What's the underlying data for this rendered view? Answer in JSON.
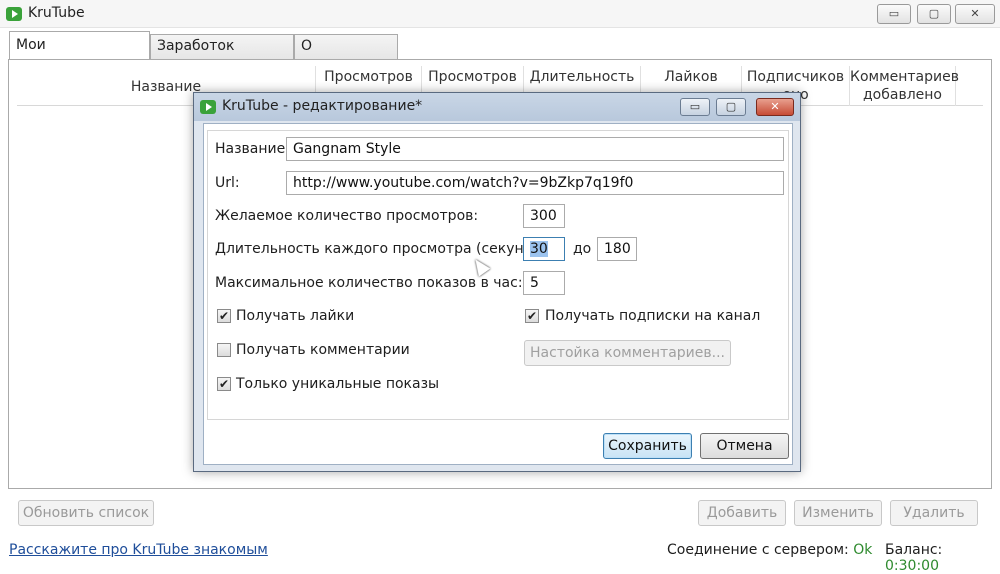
{
  "app": {
    "title": "KruTube",
    "window_buttons": {
      "minimize": "▭",
      "maximize": "▢",
      "close": "✕"
    }
  },
  "tabs": [
    {
      "label": "Мои видеоролики",
      "active": true
    },
    {
      "label": "Заработок времени",
      "active": false
    },
    {
      "label": "О программе",
      "active": false
    }
  ],
  "table": {
    "columns": [
      "Название",
      "Просмотров",
      "Просмотров",
      "Длительность",
      "Лайков",
      "Подписчиков\nено",
      "Комментариев\nдобавлено"
    ]
  },
  "bottom_buttons": {
    "refresh": "Обновить список",
    "add": "Добавить",
    "edit": "Изменить",
    "delete": "Удалить"
  },
  "status": {
    "link": "Расскажите про KruTube знакомым",
    "connection_label": "Соединение с сервером:",
    "connection_value": "Ok",
    "balance_label": "Баланс:",
    "balance_value": "0:30:00"
  },
  "dialog": {
    "title": "KruTube - редактирование*",
    "name_label": "Название:",
    "name_value": "Gangnam Style",
    "url_label": "Url:",
    "url_value": "http://www.youtube.com/watch?v=9bZkp7q19f0",
    "views_label": "Желаемое количество просмотров:",
    "views_value": "300",
    "duration_label": "Длительность каждого просмотра (секунд) от",
    "duration_from": "30",
    "duration_to_label": "до",
    "duration_to": "180",
    "max_label": "Максимальное количество показов в час:",
    "max_value": "5",
    "checkboxes": {
      "likes": {
        "label": "Получать лайки",
        "checked": true,
        "mark": "✔"
      },
      "subs": {
        "label": "Получать подписки на канал",
        "checked": true,
        "mark": "✔"
      },
      "comments": {
        "label": "Получать комментарии",
        "checked": false,
        "mark": ""
      },
      "unique": {
        "label": "Только уникальные показы",
        "checked": true,
        "mark": "✔"
      }
    },
    "comments_settings_button": "Настойка комментариев...",
    "save_button": "Сохранить",
    "cancel_button": "Отмена"
  }
}
